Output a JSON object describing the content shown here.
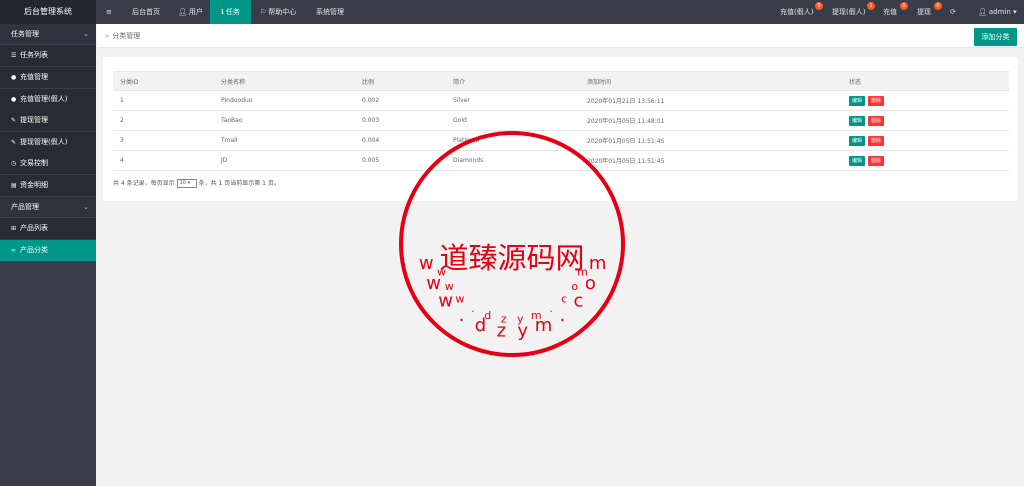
{
  "app": {
    "title": "后台管理系统"
  },
  "topnav": {
    "menu_icon": "≡",
    "items": [
      {
        "label": "后台首页",
        "icon": ""
      },
      {
        "label": "用户",
        "icon": "user-icon"
      },
      {
        "label": "任务",
        "icon": "task-icon"
      },
      {
        "label": "帮助中心",
        "icon": "flag-icon"
      },
      {
        "label": "系统管理",
        "icon": ""
      }
    ],
    "right": [
      {
        "label": "充值(假人)",
        "badge": "0"
      },
      {
        "label": "提现(假人)",
        "badge": "1"
      },
      {
        "label": "充值",
        "badge": "0"
      },
      {
        "label": "提现",
        "badge": "0"
      }
    ],
    "user": "admin"
  },
  "sidebar": {
    "groups": [
      {
        "label": "任务管理"
      },
      {
        "label": "产品管理"
      }
    ],
    "items": [
      {
        "label": "任务列表",
        "icon": "list-icon"
      },
      {
        "label": "充值管理",
        "icon": "chat-icon"
      },
      {
        "label": "充值管理(假人)",
        "icon": "chat-icon"
      },
      {
        "label": "提现管理",
        "icon": "wrench-icon"
      },
      {
        "label": "提现管理(假人)",
        "icon": "wrench-icon"
      },
      {
        "label": "交易控制",
        "icon": "clock-icon"
      },
      {
        "label": "资金明细",
        "icon": "doc-icon"
      },
      {
        "label": "产品列表",
        "icon": "cart-icon"
      },
      {
        "label": "产品分类",
        "icon": "link-icon"
      }
    ]
  },
  "breadcrumb": {
    "label": "分类管理"
  },
  "add_button": "添加分类",
  "table": {
    "headers": [
      "分类ID",
      "分类名称",
      "比例",
      "简介",
      "添加时间",
      "状态"
    ],
    "rows": [
      {
        "id": "1",
        "name": "Pinduoduo",
        "ratio": "0.002",
        "desc": "Silver",
        "time": "2020年01月21日 13:56:11"
      },
      {
        "id": "2",
        "name": "TaoBao",
        "ratio": "0.003",
        "desc": "Gold",
        "time": "2020年01月05日 11:48:01"
      },
      {
        "id": "3",
        "name": "Tmall",
        "ratio": "0.004",
        "desc": "Platinum",
        "time": "2020年01月05日 11:51:45"
      },
      {
        "id": "4",
        "name": "JD",
        "ratio": "0.005",
        "desc": "Diamonds",
        "time": "2020年01月05日 11:51:45"
      }
    ],
    "edit_label": "编辑",
    "delete_label": "删除"
  },
  "pager": {
    "prefix": "共 4 条记录，每页显示",
    "page_size": "10 ▾",
    "suffix": "条，共 1 页当前显示第 1 页。"
  },
  "watermark": {
    "center": "道臻源码网",
    "ring": "www.dzym.com",
    "color": "#e60012"
  }
}
